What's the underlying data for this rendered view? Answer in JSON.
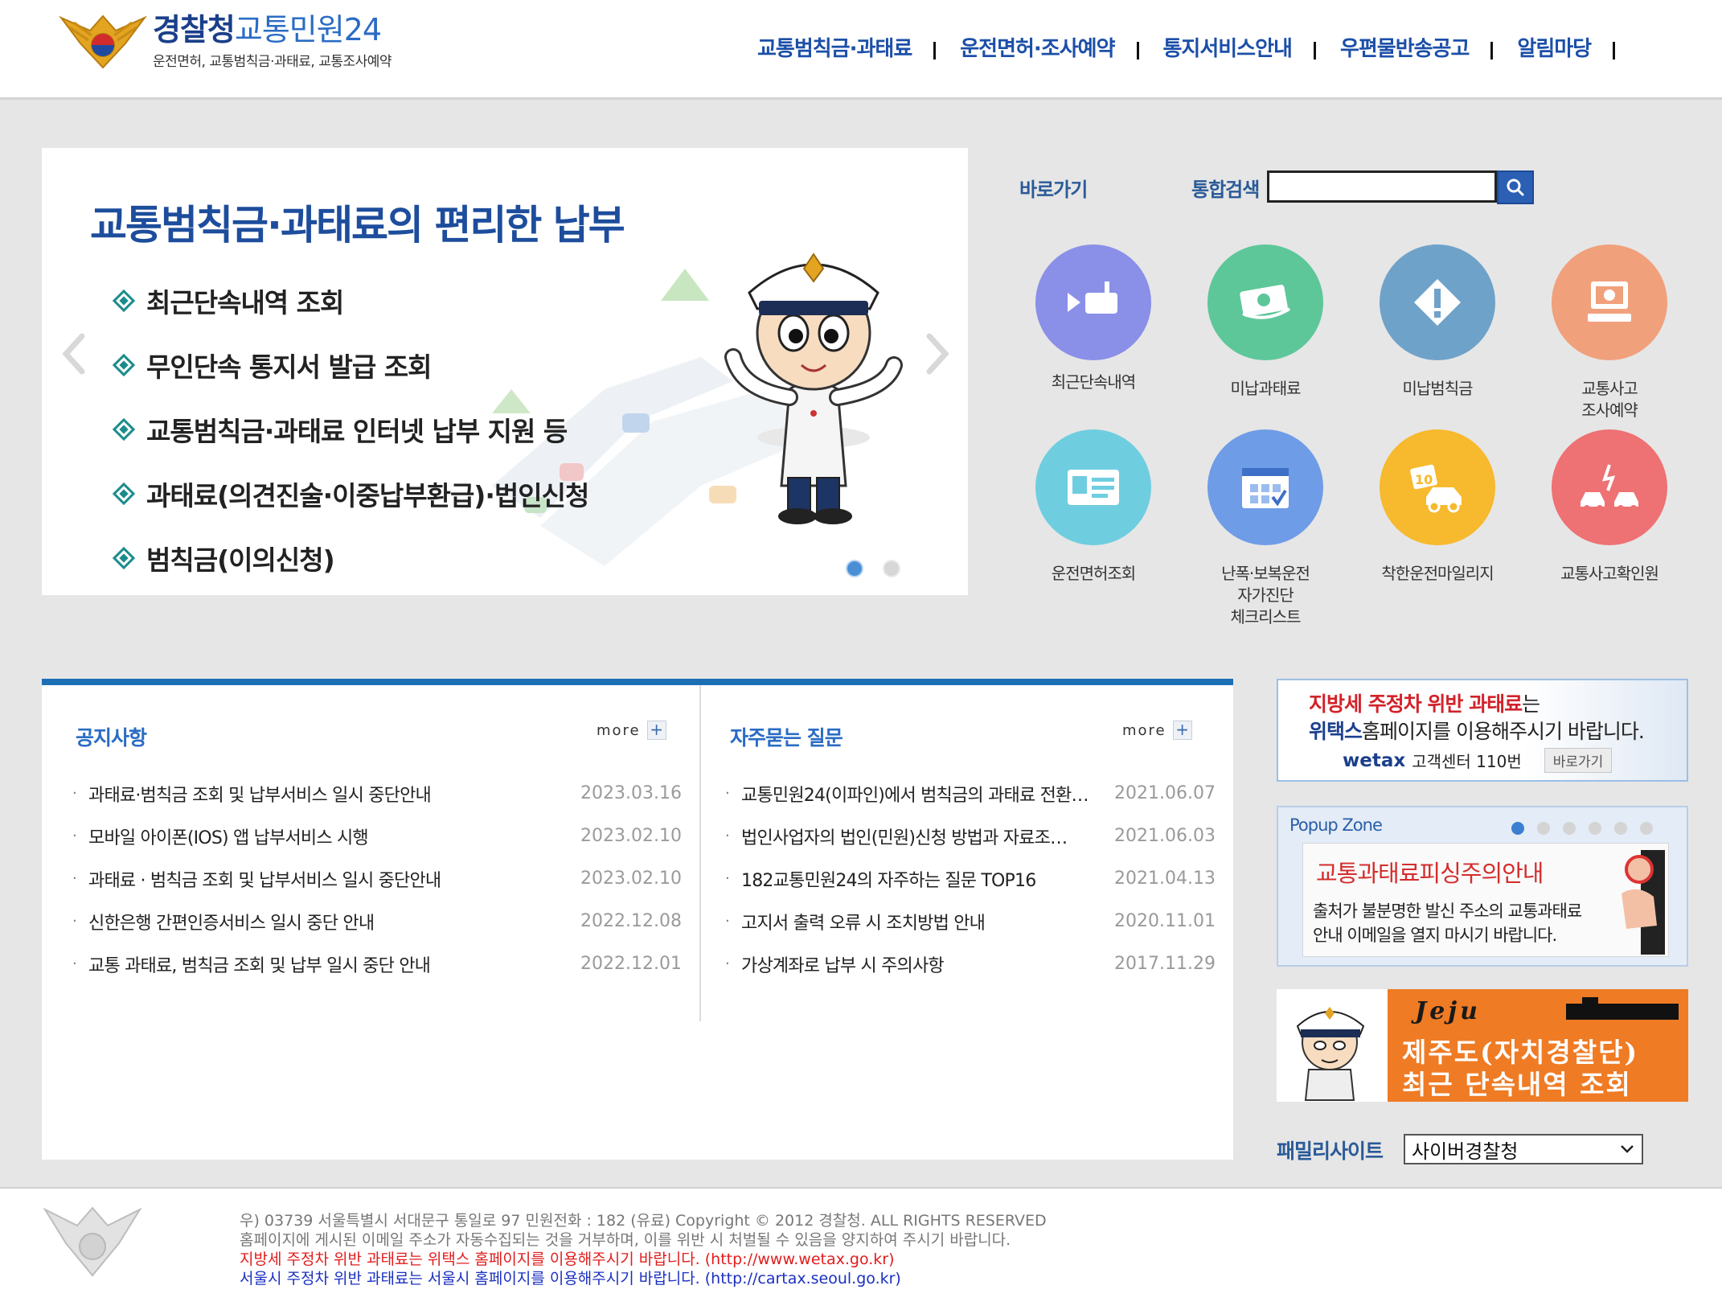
{
  "header": {
    "logo_main": "경찰청",
    "logo_accent": "교통민원24",
    "logo_sub": "운전면허, 교통범칙금·과태료, 교통조사예약",
    "nav": [
      "교통범칙금·과태료",
      "운전면허·조사예약",
      "통지서비스안내",
      "우편물반송공고",
      "알림마당"
    ]
  },
  "hero": {
    "title": "교통범칙금·과태료의 편리한 납부",
    "items": [
      "최근단속내역 조회",
      "무인단속 통지서 발급 조회",
      "교통범칙금·과태료 인터넷 납부 지원 등",
      "과태료(의견진술·이중납부환급)·법인신청",
      "범칙금(이의신청)"
    ],
    "slide_count": 2,
    "active_slide": 1
  },
  "quick": {
    "label": "바로가기",
    "search_label": "통합검색",
    "search_value": "",
    "items": [
      {
        "label": "최근단속내역",
        "icon": "camera-icon",
        "color": "#8a8fe8"
      },
      {
        "label": "미납과태료",
        "icon": "money-icon",
        "color": "#5dc79a"
      },
      {
        "label": "미납범칙금",
        "icon": "warning-icon",
        "color": "#6fa2c9"
      },
      {
        "label": "교통사고\n조사예약",
        "icon": "computer-icon",
        "color": "#f1a07c"
      },
      {
        "label": "운전면허조회",
        "icon": "license-card-icon",
        "color": "#6fcde0"
      },
      {
        "label": "난폭·보복운전\n자가진단\n체크리스트",
        "icon": "calendar-check-icon",
        "color": "#6f9ce6"
      },
      {
        "label": "착한운전마일리지",
        "icon": "mileage-car-icon",
        "color": "#f7b92d"
      },
      {
        "label": "교통사고확인원",
        "icon": "car-crash-icon",
        "color": "#ee7173"
      }
    ]
  },
  "notice": {
    "title": "공지사항",
    "more": "more",
    "rows": [
      {
        "title": "과태료·범칙금 조회 및 납부서비스 일시 중단안내",
        "date": "2023.03.16"
      },
      {
        "title": "모바일 아이폰(IOS) 앱 납부서비스 시행",
        "date": "2023.02.10"
      },
      {
        "title": "과태료 · 범칙금 조회 및 납부서비스 일시 중단안내",
        "date": "2023.02.10"
      },
      {
        "title": "신한은행 간편인증서비스 일시 중단 안내",
        "date": "2022.12.08"
      },
      {
        "title": "교통 과태료, 범칙금 조회 및 납부 일시 중단 안내",
        "date": "2022.12.01"
      }
    ]
  },
  "faq": {
    "title": "자주묻는 질문",
    "more": "more",
    "rows": [
      {
        "title": "교통민원24(이파인)에서 범칙금의 과태료 전환…",
        "date": "2021.06.07"
      },
      {
        "title": "법인사업자의 법인(민원)신청 방법과 자료조…",
        "date": "2021.06.03"
      },
      {
        "title": "182교통민원24의 자주하는 질문 TOP16",
        "date": "2021.04.13"
      },
      {
        "title": "고지서 출력 오류 시 조치방법 안내",
        "date": "2020.11.01"
      },
      {
        "title": "가상계좌로 납부 시 주의사항",
        "date": "2017.11.29"
      }
    ]
  },
  "wetax": {
    "line1_red": "지방세 주정차 위반 과태료",
    "line1_rest": "는",
    "line2_bold": "위택스",
    "line2_rest": "홈페이지를 이용해주시기 바랍니다.",
    "logo": "wetax",
    "center": "고객센터 110번",
    "go": "바로가기"
  },
  "popup": {
    "title": "Popup Zone",
    "dot_count": 6,
    "active_dot": 0,
    "headline": "교통과태료피싱주의안내",
    "body1": "출처가 불분명한 발신 주소의 교통과태료",
    "body2": "안내 이메일을 열지 마시기 바랍니다."
  },
  "jeju": {
    "signature": "Jeju",
    "line1": "제주도(자치경찰단)",
    "line2": "최근 단속내역 조회"
  },
  "family": {
    "label": "패밀리사이트",
    "selected": "사이버경찰청"
  },
  "footer": {
    "address": "우) 03739 서울특별시 서대문구 통일로 97  민원전화 : 182 (유료)      Copyright © 2012 경찰청. ALL RIGHTS RESERVED",
    "email_notice": "홈페이지에 게시된 이메일 주소가 자동수집되는 것을 거부하며, 이를 위반 시 처벌될 수 있음을 양지하여 주시기 바랍니다.",
    "wetax_notice": "지방세 주정차 위반 과태료는 위택스 홈페이지를 이용해주시기 바랍니다. (http://www.wetax.go.kr)",
    "seoul_notice": "서울시 주정차 위반 과태료는 서울시 홈페이지를 이용해주시기 바랍니다. (http://cartax.seoul.go.kr)"
  }
}
